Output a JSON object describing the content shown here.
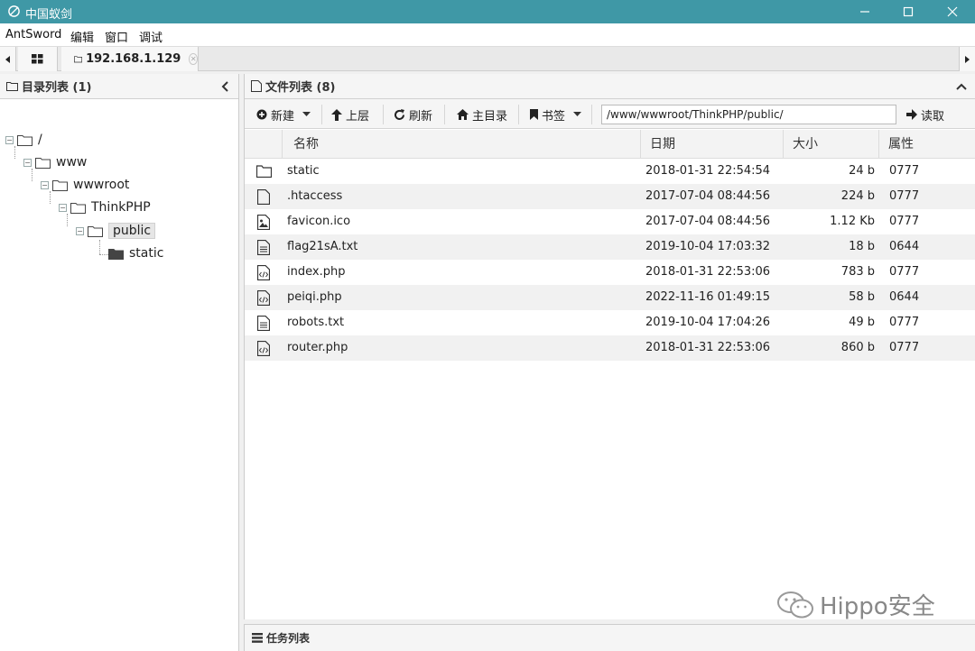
{
  "window": {
    "title": "中国蚁剑",
    "accent": "#3f98a6"
  },
  "menu": [
    "AntSword",
    "编辑",
    "窗口",
    "调试"
  ],
  "tabs": {
    "host_label": "192.168.1.129"
  },
  "dir_panel": {
    "title": "目录列表 (1)",
    "tree": [
      {
        "label": "/",
        "depth": 0
      },
      {
        "label": "www",
        "depth": 1
      },
      {
        "label": "wwwroot",
        "depth": 2
      },
      {
        "label": "ThinkPHP",
        "depth": 3
      },
      {
        "label": "public",
        "depth": 4,
        "selected": true
      },
      {
        "label": "static",
        "depth": 5
      }
    ]
  },
  "file_panel": {
    "title": "文件列表 (8)",
    "toolbar": {
      "new_label": "新建",
      "up_label": "上层",
      "refresh_label": "刷新",
      "home_label": "主目录",
      "bookmark_label": "书签",
      "path_value": "/www/wwwroot/ThinkPHP/public/",
      "read_label": "读取"
    },
    "columns": [
      "名称",
      "日期",
      "大小",
      "属性"
    ],
    "files": [
      {
        "icon": "folder-icon",
        "name": "static",
        "date": "2018-01-31 22:54:54",
        "size": "24 b",
        "attr": "0777"
      },
      {
        "icon": "file-icon",
        "name": ".htaccess",
        "date": "2017-07-04 08:44:56",
        "size": "224 b",
        "attr": "0777"
      },
      {
        "icon": "image-file-icon",
        "name": "favicon.ico",
        "date": "2017-07-04 08:44:56",
        "size": "1.12 Kb",
        "attr": "0777"
      },
      {
        "icon": "text-file-icon",
        "name": "flag21sA.txt",
        "date": "2019-10-04 17:03:32",
        "size": "18 b",
        "attr": "0644"
      },
      {
        "icon": "code-file-icon",
        "name": "index.php",
        "date": "2018-01-31 22:53:06",
        "size": "783 b",
        "attr": "0777"
      },
      {
        "icon": "code-file-icon",
        "name": "peiqi.php",
        "date": "2022-11-16 01:49:15",
        "size": "58 b",
        "attr": "0644"
      },
      {
        "icon": "text-file-icon",
        "name": "robots.txt",
        "date": "2019-10-04 17:04:26",
        "size": "49 b",
        "attr": "0777"
      },
      {
        "icon": "code-file-icon",
        "name": "router.php",
        "date": "2018-01-31 22:53:06",
        "size": "860 b",
        "attr": "0777"
      }
    ]
  },
  "task_panel": {
    "title": "任务列表"
  },
  "watermark": {
    "text": "Hippo安全"
  }
}
